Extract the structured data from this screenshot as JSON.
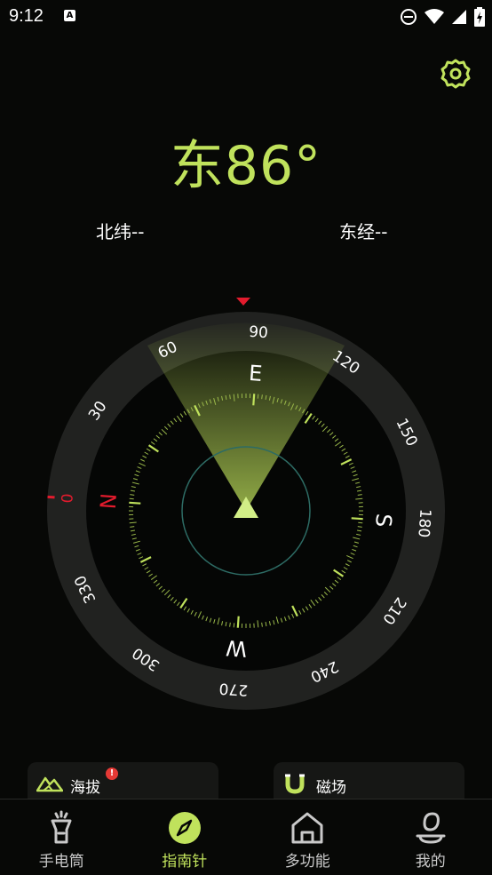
{
  "status_bar": {
    "time": "9:12",
    "notification_glyph": "A"
  },
  "heading": {
    "text": "东86°",
    "degrees": 86
  },
  "coordinates": {
    "latitude": "北纬--",
    "longitude": "东经--"
  },
  "compass": {
    "degree_labels": [
      "0",
      "30",
      "60",
      "90",
      "120",
      "150",
      "180",
      "210",
      "240",
      "270",
      "300",
      "330"
    ],
    "cardinals": {
      "N": "N",
      "E": "E",
      "S": "S",
      "W": "W"
    },
    "accent": "#c0e25c",
    "north_color": "#e21b2d"
  },
  "cards": [
    {
      "label": "海拔",
      "badge": "!"
    },
    {
      "label": "磁场"
    }
  ],
  "nav": [
    {
      "label": "手电筒",
      "icon": "flashlight-icon"
    },
    {
      "label": "指南针",
      "icon": "compass-icon",
      "active": true
    },
    {
      "label": "多功能",
      "icon": "home-icon"
    },
    {
      "label": "我的",
      "icon": "profile-icon"
    }
  ]
}
